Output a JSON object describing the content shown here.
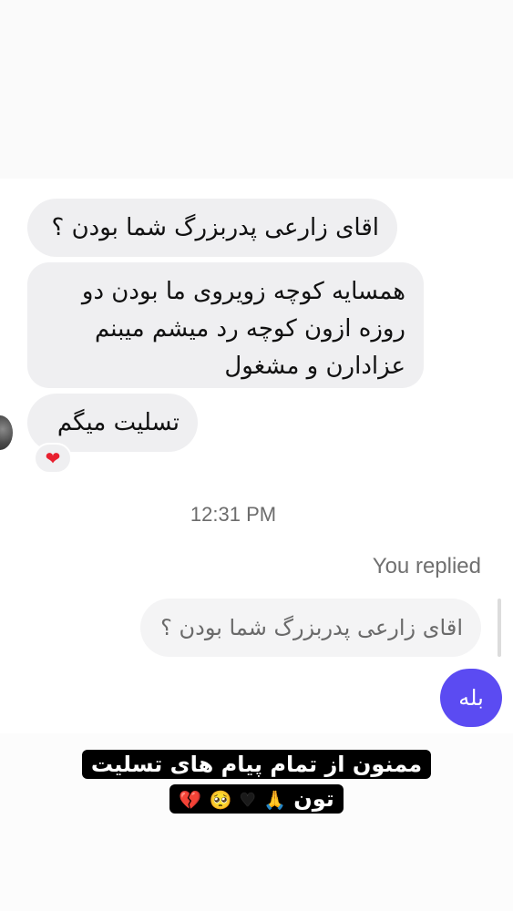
{
  "conversation": {
    "incoming_messages": [
      {
        "text": "اقای زارعی پدربزرگ شما بودن ؟"
      },
      {
        "lines": [
          "همسایه کوچه زویروی ما بودن دو",
          "روزه ازون کوچه رد میشم میبنم",
          "عزادارن و مشغول"
        ]
      },
      {
        "text": "تسلیت میگم"
      }
    ],
    "reaction": "❤",
    "timestamp": "12:31 PM",
    "replied_label": "You replied",
    "quoted_message": "اقای زارعی پدربزرگ شما بودن ؟",
    "sent_message": "بله"
  },
  "story_caption": {
    "line1": "ممنون از تمام پیام های تسلیت",
    "line2_text": "تون",
    "emojis": [
      "🙏",
      "♥",
      "🥺",
      "💔"
    ]
  },
  "colors": {
    "incoming_bubble": "#efeff1",
    "sent_bubble": "#5b4bf2",
    "caption_background": "#000000"
  }
}
